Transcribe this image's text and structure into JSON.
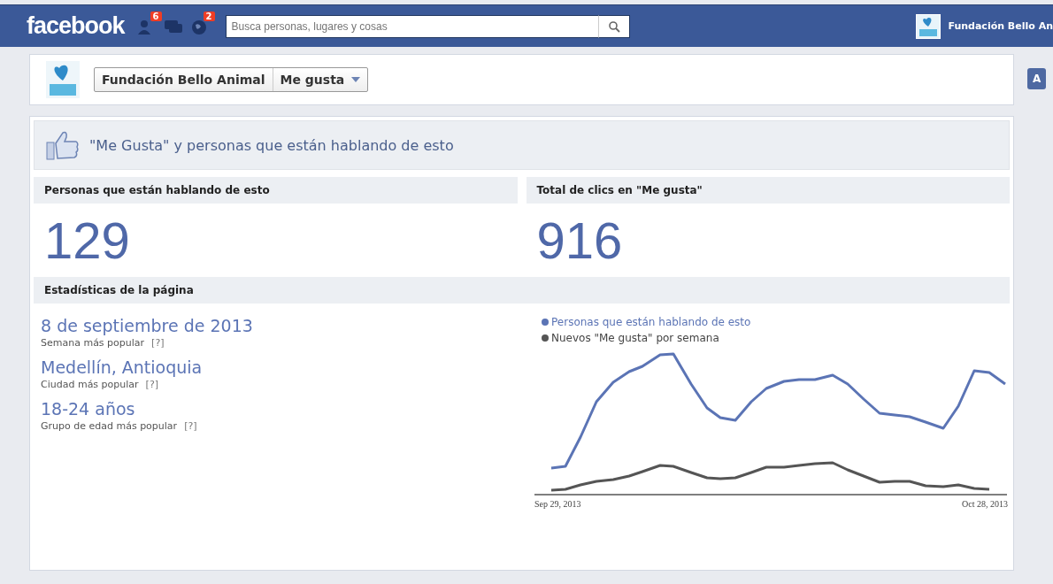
{
  "topbar": {
    "logo": "facebook",
    "friend_requests_badge": "6",
    "notifications_badge": "2",
    "search": {
      "placeholder": "Busca personas, lugares y cosas"
    },
    "profile_name": "Fundación Bello An"
  },
  "page_header": {
    "page_name": "Fundación Bello Animal",
    "like_button": "Me gusta",
    "side_button": "A"
  },
  "section_title": "\"Me Gusta\" y personas que están hablando de esto",
  "stats": [
    {
      "label": "Personas que están hablando de esto",
      "value": "129"
    },
    {
      "label": "Total de clics en \"Me gusta\"",
      "value": "916"
    }
  ],
  "page_stats": {
    "title": "Estadísticas de la página",
    "items": [
      {
        "value": "8 de septiembre de 2013",
        "caption": "Semana más popular",
        "help": "[?]"
      },
      {
        "value": "Medellín, Antioquia",
        "caption": "Ciudad más popular",
        "help": "[?]"
      },
      {
        "value": "18-24 años",
        "caption": "Grupo de edad más popular",
        "help": "[?]"
      }
    ],
    "legend": [
      {
        "label": "Personas que están hablando de esto",
        "color": "#5b74b5"
      },
      {
        "label": "Nuevos \"Me gusta\" por semana",
        "color": "#555555"
      }
    ],
    "x_start": "Sep 29, 2013",
    "x_end": "Oct 28, 2013"
  }
}
